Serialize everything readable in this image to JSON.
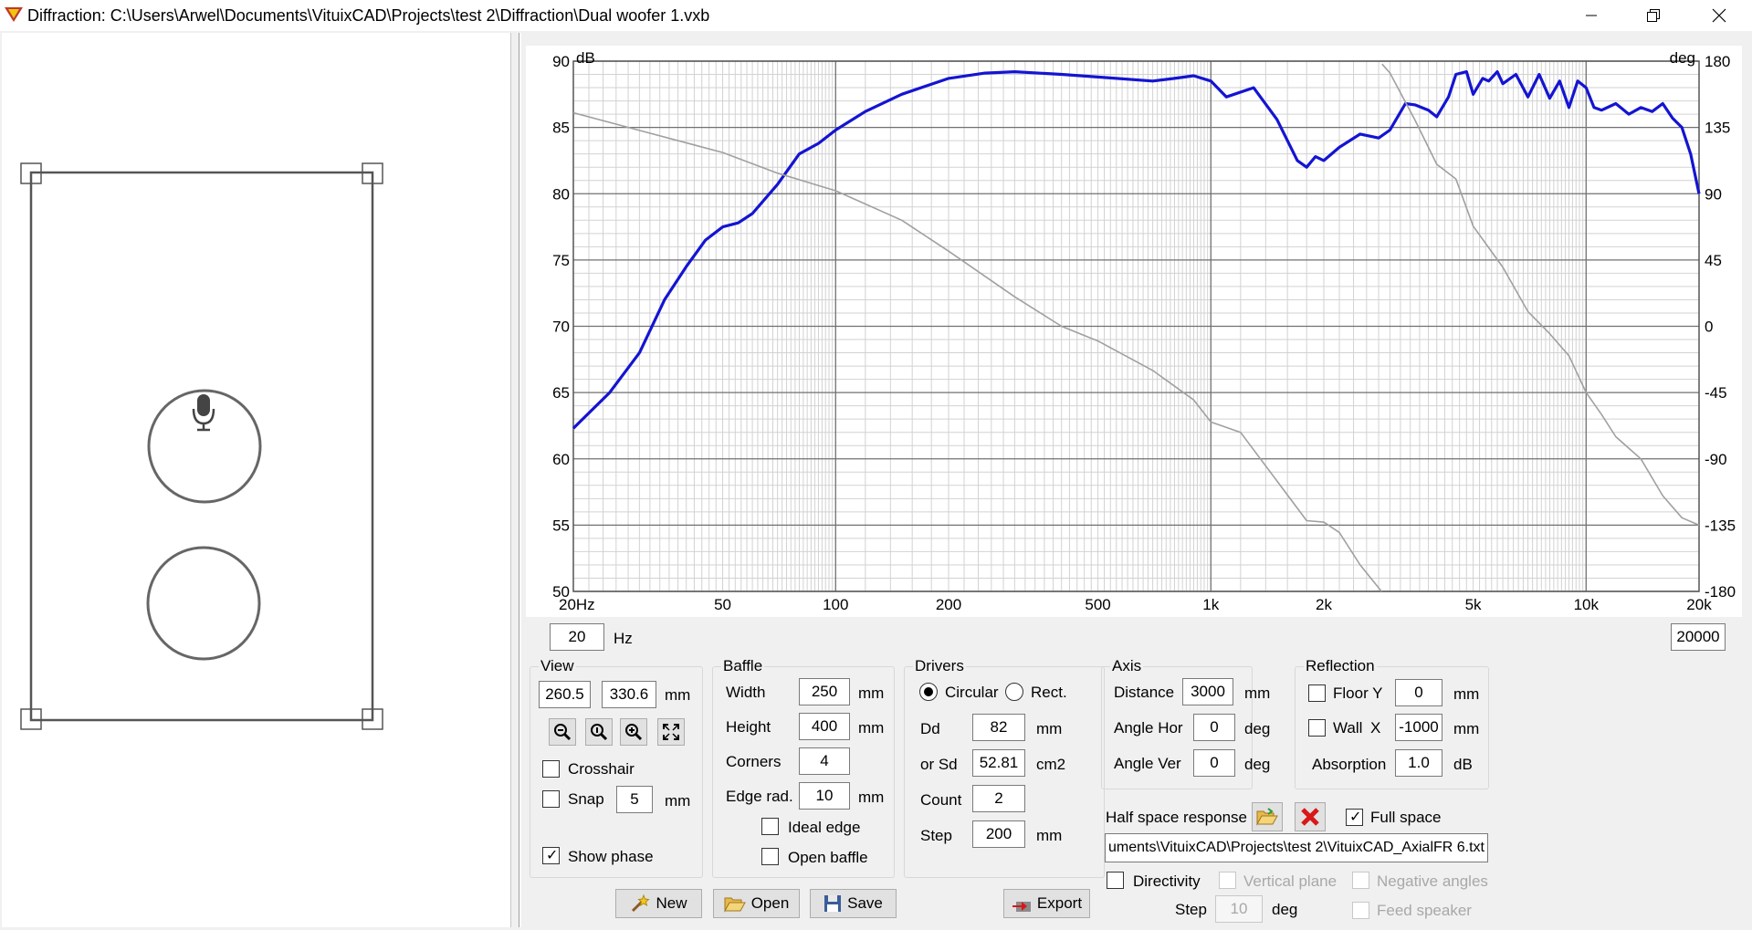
{
  "window": {
    "title": "Diffraction: C:\\Users\\Arwel\\Documents\\VituixCAD\\Projects\\test 2\\Diffraction\\Dual woofer 1.vxb"
  },
  "graph": {
    "left_unit": "dB",
    "right_unit": "deg",
    "db_ticks": [
      "90",
      "85",
      "80",
      "75",
      "70",
      "65",
      "60",
      "55",
      "50"
    ],
    "deg_ticks": [
      "180",
      "135",
      "90",
      "45",
      "0",
      "-45",
      "-90",
      "-135",
      "-180"
    ],
    "freq_ticks": [
      {
        "f": 20,
        "label": "20Hz"
      },
      {
        "f": 50,
        "label": "50"
      },
      {
        "f": 100,
        "label": "100"
      },
      {
        "f": 200,
        "label": "200"
      },
      {
        "f": 500,
        "label": "500"
      },
      {
        "f": 1000,
        "label": "1k"
      },
      {
        "f": 2000,
        "label": "2k"
      },
      {
        "f": 5000,
        "label": "5k"
      },
      {
        "f": 10000,
        "label": "10k"
      },
      {
        "f": 20000,
        "label": "20k"
      }
    ],
    "min_freq": "20",
    "max_freq": "20000",
    "hz_label": "Hz"
  },
  "chart_data": {
    "type": "line",
    "xlabel": "",
    "ylabel": "dB",
    "y2label": "deg",
    "xscale": "log",
    "xlim": [
      20,
      20000
    ],
    "ylim": [
      50,
      90
    ],
    "y2lim": [
      -180,
      180
    ],
    "grid": true,
    "series": [
      {
        "axis": "left",
        "color": "#1414d2",
        "x": [
          20,
          25,
          30,
          35,
          40,
          45,
          50,
          55,
          60,
          70,
          80,
          90,
          100,
          120,
          150,
          200,
          250,
          300,
          400,
          500,
          700,
          800,
          900,
          1000,
          1100,
          1300,
          1500,
          1700,
          1800,
          1900,
          2000,
          2200,
          2500,
          2800,
          3000,
          3300,
          3500,
          3800,
          4000,
          4300,
          4500,
          4800,
          5000,
          5300,
          5500,
          5800,
          6000,
          6500,
          7000,
          7500,
          8000,
          8500,
          9000,
          9500,
          10000,
          10500,
          11000,
          12000,
          13000,
          14000,
          15000,
          16000,
          17000,
          18000,
          19000,
          20000
        ],
        "y": [
          62.3,
          65,
          68,
          72,
          74.5,
          76.5,
          77.5,
          77.8,
          78.5,
          80.7,
          83,
          83.8,
          84.8,
          86.2,
          87.5,
          88.7,
          89.1,
          89.2,
          89,
          88.8,
          88.5,
          88.7,
          88.9,
          88.5,
          87.3,
          88,
          85.6,
          82.5,
          82,
          82.8,
          82.5,
          83.5,
          84.5,
          84.2,
          84.8,
          86.8,
          86.7,
          86.3,
          85.8,
          87.3,
          89,
          89.2,
          87.5,
          88.7,
          88.5,
          89.2,
          88.3,
          89,
          87.3,
          89,
          87.2,
          88.5,
          86.5,
          88.5,
          88,
          86.5,
          86.3,
          86.8,
          86,
          86.5,
          86.2,
          86.8,
          85.7,
          85,
          83,
          80
        ]
      },
      {
        "axis": "right",
        "color": "#a0a0a0",
        "x": [
          20,
          30,
          50,
          70,
          100,
          150,
          200,
          300,
          400,
          500,
          700,
          900,
          1000,
          1200,
          1500,
          1800,
          2000,
          2200,
          2500,
          2850,
          2860,
          3000,
          3500,
          4000,
          4500,
          5000,
          6000,
          7000,
          8000,
          9000,
          10000,
          11000,
          12000,
          14000,
          16000,
          18000,
          20000
        ],
        "y": [
          145,
          133,
          118,
          104,
          92,
          72,
          51,
          20,
          0,
          -10,
          -30,
          -50,
          -65,
          -72,
          -105,
          -132,
          -133,
          -140,
          -162,
          -180,
          178,
          172,
          140,
          110,
          100,
          68,
          40,
          10,
          -5,
          -20,
          -45,
          -60,
          -75,
          -90,
          -115,
          -130,
          -135
        ]
      }
    ]
  },
  "view": {
    "group": "View",
    "x": "260.5",
    "y": "330.6",
    "unit": "mm",
    "crosshair": "Crosshair",
    "snap": "Snap",
    "snap_value": "5",
    "snap_unit": "mm",
    "show_phase": "Show phase"
  },
  "baffle": {
    "group": "Baffle",
    "width_label": "Width",
    "width": "250",
    "height_label": "Height",
    "height": "400",
    "corners_label": "Corners",
    "corners": "4",
    "edge_label": "Edge rad.",
    "edge": "10",
    "mm": "mm",
    "ideal_edge": "Ideal edge",
    "open_baffle": "Open baffle"
  },
  "drivers": {
    "group": "Drivers",
    "circular": "Circular",
    "rect": "Rect.",
    "dd_label": "Dd",
    "dd": "82",
    "dd_unit": "mm",
    "sd_label": "or Sd",
    "sd": "52.81",
    "sd_unit": "cm2",
    "count_label": "Count",
    "count": "2",
    "step_label": "Step",
    "step": "200",
    "step_unit": "mm"
  },
  "axis": {
    "group": "Axis",
    "distance_label": "Distance",
    "distance": "3000",
    "distance_unit": "mm",
    "hor_label": "Angle Hor",
    "hor": "0",
    "ver_label": "Angle Ver",
    "ver": "0",
    "deg": "deg"
  },
  "reflection": {
    "group": "Reflection",
    "floor_label": "Floor Y",
    "floor": "0",
    "wall_label": "Wall",
    "wall_axis": "X",
    "wall": "-1000",
    "mm": "mm",
    "absorption_label": "Absorption",
    "absorption": "1.0",
    "absorption_unit": "dB"
  },
  "halfspace": {
    "label": "Half space response",
    "full_space": "Full space",
    "path": "uments\\VituixCAD\\Projects\\test 2\\VituixCAD_AxialFR 6.txt"
  },
  "directivity": {
    "label": "Directivity",
    "vertical_plane": "Vertical plane",
    "negative_angles": "Negative angles",
    "step_label": "Step",
    "step": "10",
    "step_unit": "deg",
    "feed_speaker": "Feed speaker"
  },
  "buttons": {
    "new": "New",
    "open": "Open",
    "save": "Save",
    "export": "Export"
  }
}
